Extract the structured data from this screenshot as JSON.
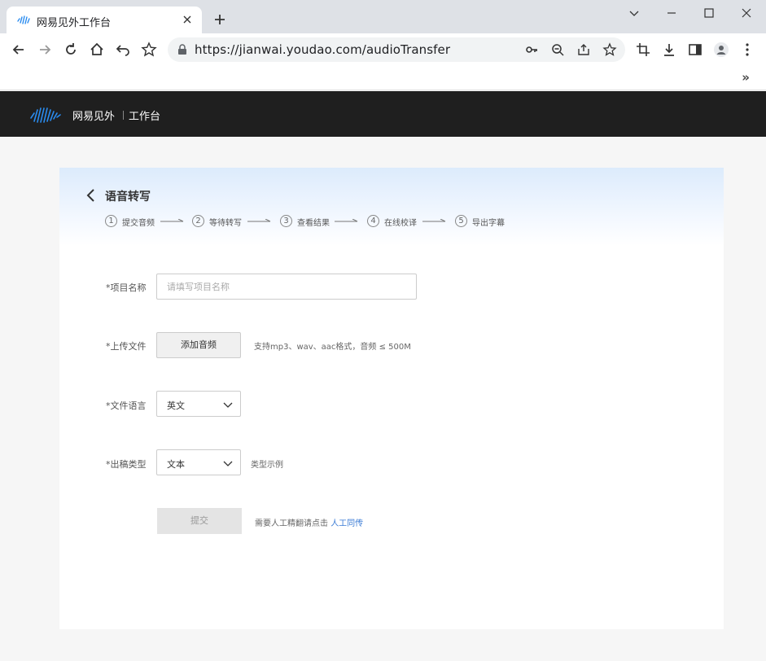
{
  "browser": {
    "tab_title": "网易见外工作台",
    "url": "https://jianwai.youdao.com/audioTransfer",
    "overflow_label": "»"
  },
  "app": {
    "brand": "网易见外",
    "sub_brand": "工作台"
  },
  "page": {
    "title": "语音转写",
    "steps": [
      {
        "num": "1",
        "label": "提交音频"
      },
      {
        "num": "2",
        "label": "等待转写"
      },
      {
        "num": "3",
        "label": "查看结果"
      },
      {
        "num": "4",
        "label": "在线校译"
      },
      {
        "num": "5",
        "label": "导出字幕"
      }
    ]
  },
  "form": {
    "project_name_label": "*项目名称",
    "project_name_placeholder": "请填写项目名称",
    "project_name_value": "",
    "upload_label": "*上传文件",
    "upload_button": "添加音频",
    "upload_hint": "支持mp3、wav、aac格式，音频 ≤ 500M",
    "language_label": "*文件语言",
    "language_value": "英文",
    "output_label": "*出稿类型",
    "output_value": "文本",
    "output_example": "类型示例",
    "submit_button": "提交",
    "human_hint": "需要人工精翻请点击",
    "human_link": "人工同传"
  },
  "colors": {
    "header_bg": "#1f1f1f",
    "link": "#3a7bd5",
    "logo_blue": "#2a8cf0"
  }
}
